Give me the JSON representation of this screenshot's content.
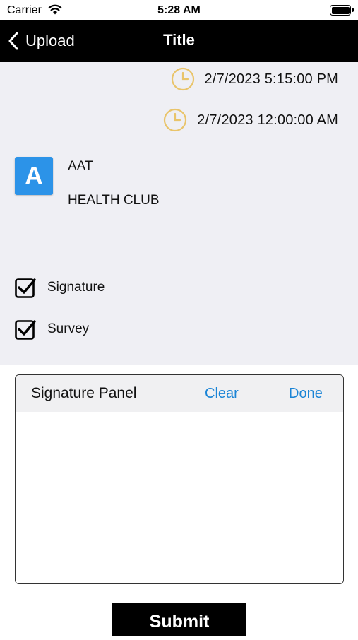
{
  "status_bar": {
    "carrier": "Carrier",
    "time": "5:28 AM",
    "wifi_icon": "wifi-icon",
    "battery_icon": "battery-icon"
  },
  "nav": {
    "back_label": "Upload",
    "title": "Title",
    "back_icon": "chevron-left-icon"
  },
  "dates": [
    {
      "icon": "clock-icon",
      "text": "2/7/2023 5:15:00 PM"
    },
    {
      "icon": "clock-icon",
      "text": "2/7/2023 12:00:00 AM"
    }
  ],
  "organization": {
    "avatar_letter": "A",
    "line1": "AAT",
    "line2": "HEALTH CLUB"
  },
  "checks": [
    {
      "label": "Signature",
      "checked": true
    },
    {
      "label": "Survey",
      "checked": true
    }
  ],
  "signature_panel": {
    "title": "Signature Panel",
    "clear_label": "Clear",
    "done_label": "Done"
  },
  "submit_label": "Submit",
  "colors": {
    "nav_bg": "#000000",
    "content_bg": "#efeff4",
    "accent_blue": "#1a84d6",
    "avatar_bg": "#2c93e8",
    "clock_color": "#e9c46a"
  }
}
